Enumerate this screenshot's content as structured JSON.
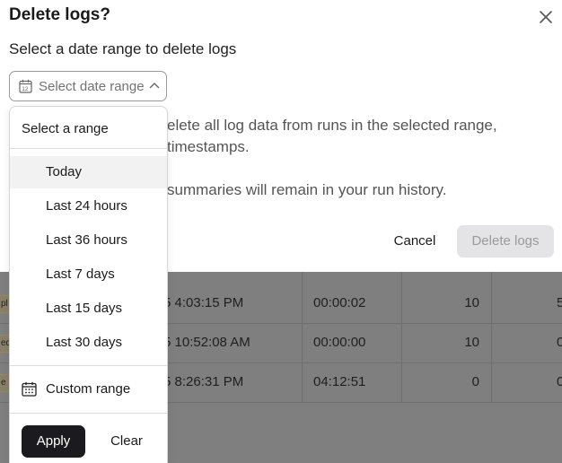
{
  "modal": {
    "title": "Delete logs?",
    "subtitle": "Select a date range to delete logs",
    "date_select": {
      "placeholder": "Select date range",
      "icon": "calendar-icon"
    },
    "description_line1": "elete all log data from runs in the selected range,",
    "description_line2": "timestamps.",
    "description_line3": "summaries will remain in your run history.",
    "cancel_label": "Cancel",
    "delete_label": "Delete logs"
  },
  "dropdown": {
    "heading": "Select a range",
    "options": [
      {
        "label": "Today"
      },
      {
        "label": "Last 24 hours"
      },
      {
        "label": "Last 36 hours"
      },
      {
        "label": "Last 7 days"
      },
      {
        "label": "Last 15 days"
      },
      {
        "label": "Last 30 days"
      }
    ],
    "custom_label": "Custom range",
    "apply_label": "Apply",
    "clear_label": "Clear"
  },
  "background_table": {
    "rows": [
      {
        "tag": "pl",
        "time": "5 4:03:15 PM",
        "duration": "00:00:02",
        "count": "10",
        "tail": "5"
      },
      {
        "tag": "ed",
        "time": "5 10:52:08 AM",
        "duration": "00:00:00",
        "count": "10",
        "tail": "0"
      },
      {
        "tag": "e",
        "time": "5 8:26:31 PM",
        "duration": "04:12:51",
        "count": "0",
        "tail": "0"
      }
    ]
  },
  "colors": {
    "primary_button": "#1b1b1f",
    "disabled_button_bg": "#e4e4e6",
    "overlay": "#7f7f7f"
  }
}
